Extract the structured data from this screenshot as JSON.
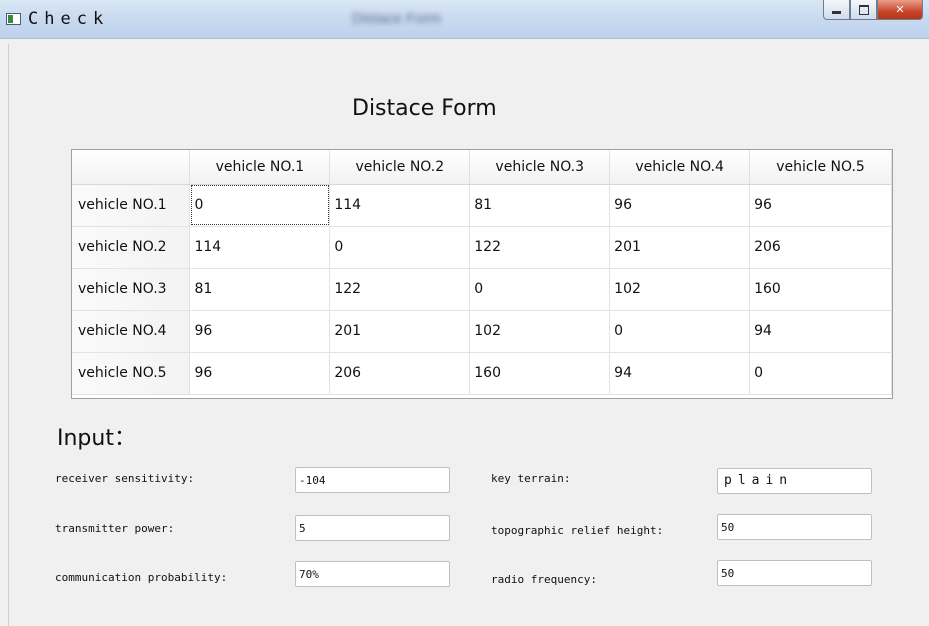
{
  "window": {
    "title": "Check",
    "blurred_caption": "Distace Form"
  },
  "form": {
    "title": "Distace Form"
  },
  "table": {
    "columns": [
      "vehicle NO.1",
      "vehicle NO.2",
      "vehicle NO.3",
      "vehicle NO.4",
      "vehicle NO.5"
    ],
    "rows": [
      {
        "label": "vehicle NO.1",
        "cells": [
          "0",
          "114",
          "81",
          "96",
          "96"
        ]
      },
      {
        "label": "vehicle NO.2",
        "cells": [
          "114",
          "0",
          "122",
          "201",
          "206"
        ]
      },
      {
        "label": "vehicle NO.3",
        "cells": [
          "81",
          "122",
          "0",
          "102",
          "160"
        ]
      },
      {
        "label": "vehicle NO.4",
        "cells": [
          "96",
          "201",
          "102",
          "0",
          "94"
        ]
      },
      {
        "label": "vehicle NO.5",
        "cells": [
          "96",
          "206",
          "160",
          "94",
          "0"
        ]
      }
    ]
  },
  "input": {
    "heading": "Input：",
    "receiver_sensitivity": {
      "label": "receiver sensitivity:",
      "value": "-104"
    },
    "transmitter_power": {
      "label": "transmitter power:",
      "value": "5"
    },
    "communication_probability": {
      "label": "communication probability:",
      "value": "70%"
    },
    "key_terrain": {
      "label": "key terrain:",
      "value": "plain"
    },
    "relief_height": {
      "label": "topographic relief height:",
      "value": "50"
    },
    "radio_frequency": {
      "label": "radio frequency:",
      "value": "50"
    }
  }
}
